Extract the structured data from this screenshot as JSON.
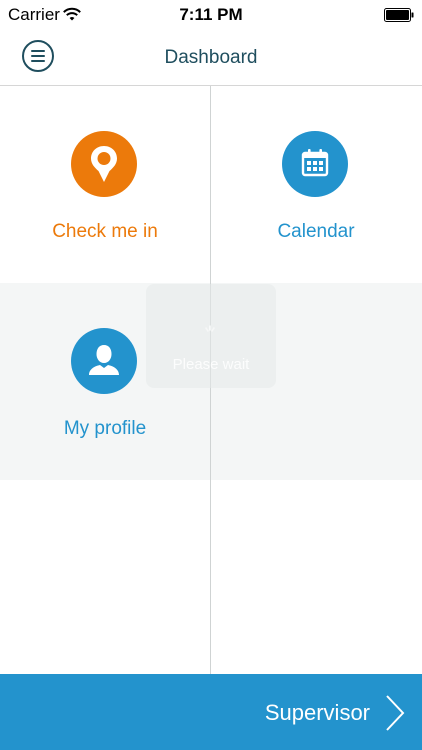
{
  "status_bar": {
    "carrier": "Carrier",
    "time": "7:11 PM",
    "icons": [
      "wifi-icon",
      "battery-icon"
    ]
  },
  "nav": {
    "title": "Dashboard",
    "menu_icon": "hamburger-menu-icon"
  },
  "tiles": [
    {
      "label": "Check me in",
      "icon": "location-pin-icon",
      "color": "#ec7a0b"
    },
    {
      "label": "Calendar",
      "icon": "calendar-icon",
      "color": "#2393cd"
    },
    {
      "label": "My profile",
      "icon": "user-profile-icon",
      "color": "#2393cd"
    }
  ],
  "loading": {
    "message": "Please wait"
  },
  "footer": {
    "label": "Supervisor",
    "icon": "chevron-right-icon"
  },
  "colors": {
    "accent_blue": "#2393cd",
    "accent_orange": "#ec7a0b",
    "nav_text": "#1f4e5e"
  }
}
